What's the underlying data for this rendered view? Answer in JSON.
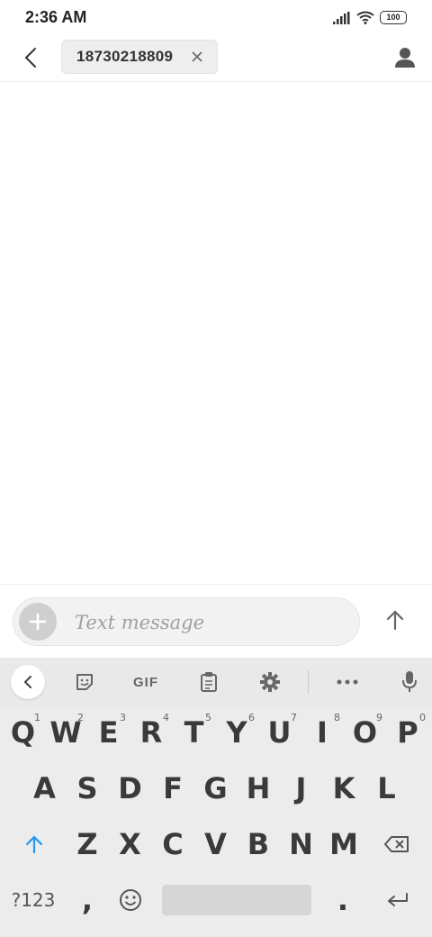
{
  "status_bar": {
    "time": "2:36 AM",
    "battery": "100"
  },
  "header": {
    "recipient": "18730218809"
  },
  "compose": {
    "placeholder": "Text message"
  },
  "keyboard": {
    "toolbar": {
      "gif_label": "GIF"
    },
    "row1": [
      {
        "key": "Q",
        "hint": "1"
      },
      {
        "key": "W",
        "hint": "2"
      },
      {
        "key": "E",
        "hint": "3"
      },
      {
        "key": "R",
        "hint": "4"
      },
      {
        "key": "T",
        "hint": "5"
      },
      {
        "key": "Y",
        "hint": "6"
      },
      {
        "key": "U",
        "hint": "7"
      },
      {
        "key": "I",
        "hint": "8"
      },
      {
        "key": "O",
        "hint": "9"
      },
      {
        "key": "P",
        "hint": "0"
      }
    ],
    "row2": [
      "A",
      "S",
      "D",
      "F",
      "G",
      "H",
      "J",
      "K",
      "L"
    ],
    "row3": [
      "Z",
      "X",
      "C",
      "V",
      "B",
      "N",
      "M"
    ],
    "symbols_label": "?123",
    "comma": ",",
    "period": "."
  },
  "colors": {
    "accent": "#2196f3",
    "keyboard_bg": "#ececec"
  }
}
